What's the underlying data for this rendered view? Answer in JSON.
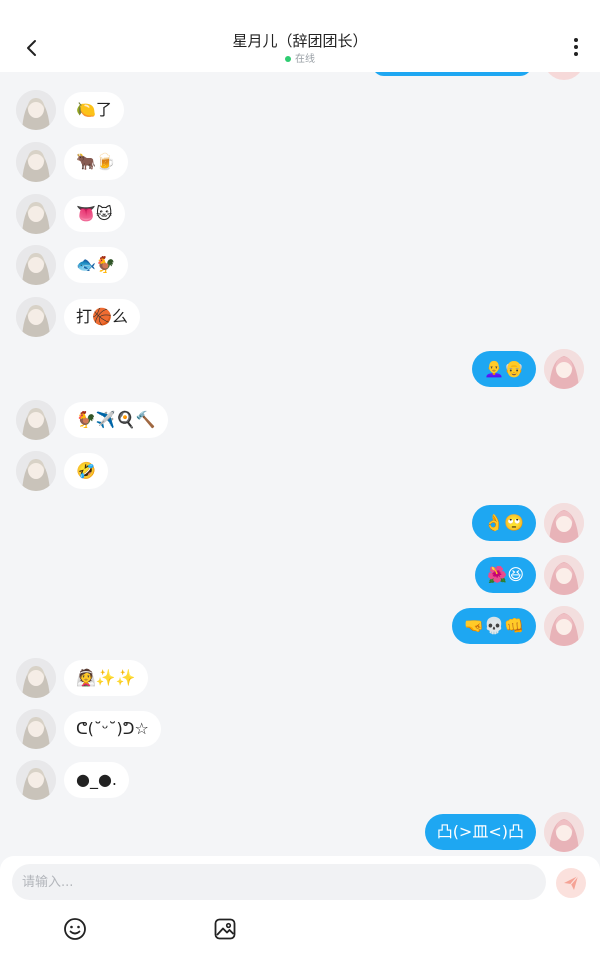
{
  "header": {
    "title": "星月儿（辞团团长）",
    "status": "在线"
  },
  "messages": [
    {
      "side": "in",
      "text": "🍋了"
    },
    {
      "side": "in",
      "text": "🐂🍺"
    },
    {
      "side": "in",
      "text": "👅🐱"
    },
    {
      "side": "in",
      "text": "🐟🐓"
    },
    {
      "side": "in",
      "text": "打🏀么"
    },
    {
      "side": "out",
      "text": "👩‍🦲👴"
    },
    {
      "side": "in",
      "text": "🐓✈️🍳🔨"
    },
    {
      "side": "in",
      "text": "🤣"
    },
    {
      "side": "out",
      "text": "👌🙄"
    },
    {
      "side": "out",
      "text": "🌺😆"
    },
    {
      "side": "out",
      "text": "🤜💀👊"
    },
    {
      "side": "in",
      "text": "👰✨✨"
    },
    {
      "side": "in",
      "text": "ᕦ(˘ᵕ˘)ᕤ☆"
    },
    {
      "side": "in",
      "text": "●_●."
    },
    {
      "side": "out",
      "text": "凸(>皿<)凸"
    }
  ],
  "composer": {
    "placeholder": "请输入..."
  },
  "icons": {
    "back": "chevron-left-icon",
    "more": "more-vertical-icon",
    "send": "send-icon",
    "emoji": "emoji-icon",
    "image": "image-icon"
  },
  "colors": {
    "accent": "#1ea7f2",
    "online": "#2ecc71",
    "send_disabled": "#fbe1dd"
  }
}
